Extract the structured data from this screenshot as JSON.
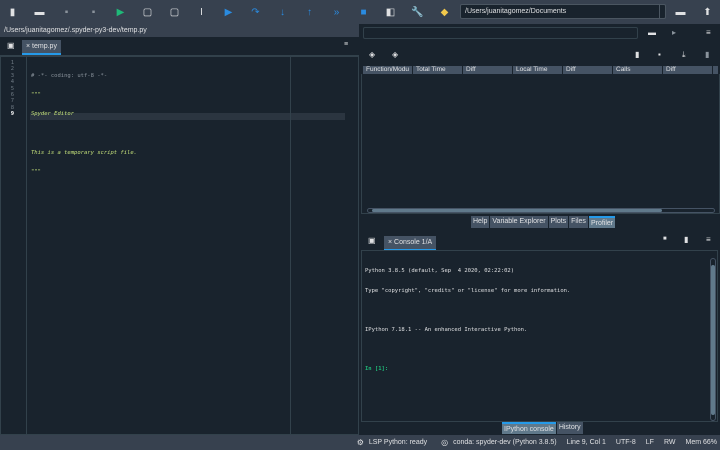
{
  "toolbar": {
    "icons": [
      "new-file-icon",
      "open-file-icon",
      "save-icon",
      "save-all-icon",
      "run-icon",
      "run-cell-icon",
      "run-cell-advance-icon",
      "run-selection-icon",
      "debug-icon",
      "step-icon",
      "step-into-icon",
      "step-return-icon",
      "continue-icon",
      "stop-icon",
      "maximize-pane-icon",
      "preferences-icon",
      "python-path-icon"
    ],
    "cwd": "/Users/juanitagomez/Documents"
  },
  "editor": {
    "file_path": "/Users/juanitagomez/.spyder-py3-dev/temp.py",
    "tab": "temp.py",
    "line_numbers": [
      "1",
      "2",
      "3",
      "4",
      "5",
      "6",
      "7",
      "8",
      "9"
    ],
    "lines": [
      "# -*- coding: utf-8 -*-",
      "\"\"\"",
      "Spyder Editor",
      "",
      "This is a temporary script file.",
      "\"\"\"",
      "",
      "",
      ""
    ]
  },
  "profiler": {
    "columns": [
      "Function/Modu",
      "Total Time",
      "Diff",
      "Local Time",
      "Diff",
      "Calls",
      "Diff"
    ]
  },
  "top_tabs": [
    {
      "label": "Help"
    },
    {
      "label": "Variable Explorer"
    },
    {
      "label": "Plots"
    },
    {
      "label": "Files"
    },
    {
      "label": "Profiler",
      "active": true
    }
  ],
  "console": {
    "tab": "Console 1/A",
    "lines": [
      "Python 3.8.5 (default, Sep  4 2020, 02:22:02)",
      "Type \"copyright\", \"credits\" or \"license\" for more information.",
      "",
      "IPython 7.18.1 -- An enhanced Interactive Python.",
      ""
    ],
    "prompt": "In [1]:"
  },
  "bottom_tabs": [
    {
      "label": "IPython console",
      "active": true
    },
    {
      "label": "History"
    }
  ],
  "status": {
    "lsp": "LSP Python: ready",
    "conda": "conda: spyder-dev (Python 3.8.5)",
    "position": "Line 9, Col 1",
    "encoding": "UTF-8",
    "eol": "LF",
    "perm": "RW",
    "mem": "Mem 66%"
  },
  "colors": {
    "accent": "#259ae9",
    "run": "#1fb978",
    "debug": "#2a8be0",
    "background": "#19232d"
  }
}
